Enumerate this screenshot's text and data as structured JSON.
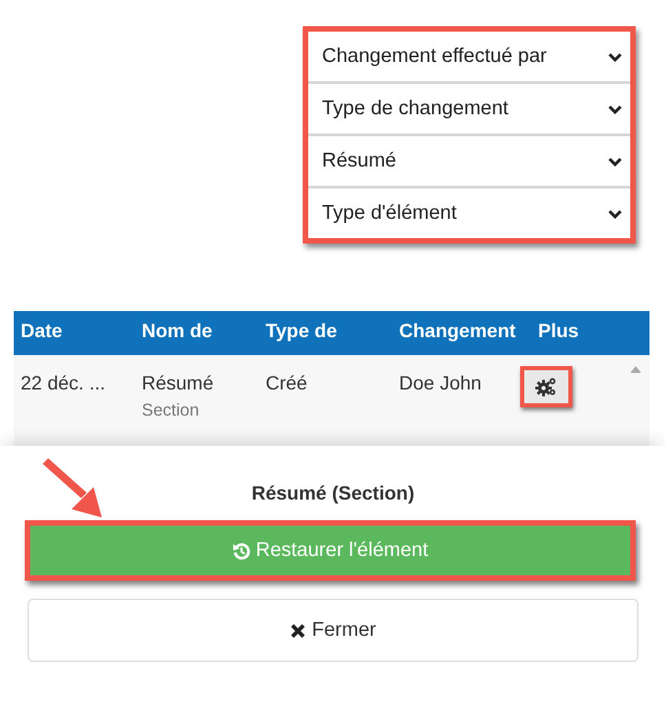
{
  "filters": {
    "highlighted": true,
    "items": [
      {
        "label": "Changement effectué par"
      },
      {
        "label": "Type de changement"
      },
      {
        "label": "Résumé"
      },
      {
        "label": "Type d'élément"
      }
    ]
  },
  "table": {
    "columns": [
      "Date",
      "Nom de",
      "Type de",
      "Changement",
      "Plus"
    ],
    "rows": [
      {
        "date": "22 déc. ...",
        "name": "Résumé",
        "subtype": "Section",
        "change_type": "Créé",
        "changed_by": "Doe John",
        "action_highlighted": true
      }
    ]
  },
  "dialog": {
    "title": "Résumé (Section)",
    "restore_button": {
      "label": "Restaurer l'élément",
      "highlighted": true
    },
    "close_button": {
      "label": "Fermer"
    }
  },
  "annotation_arrow": true
}
